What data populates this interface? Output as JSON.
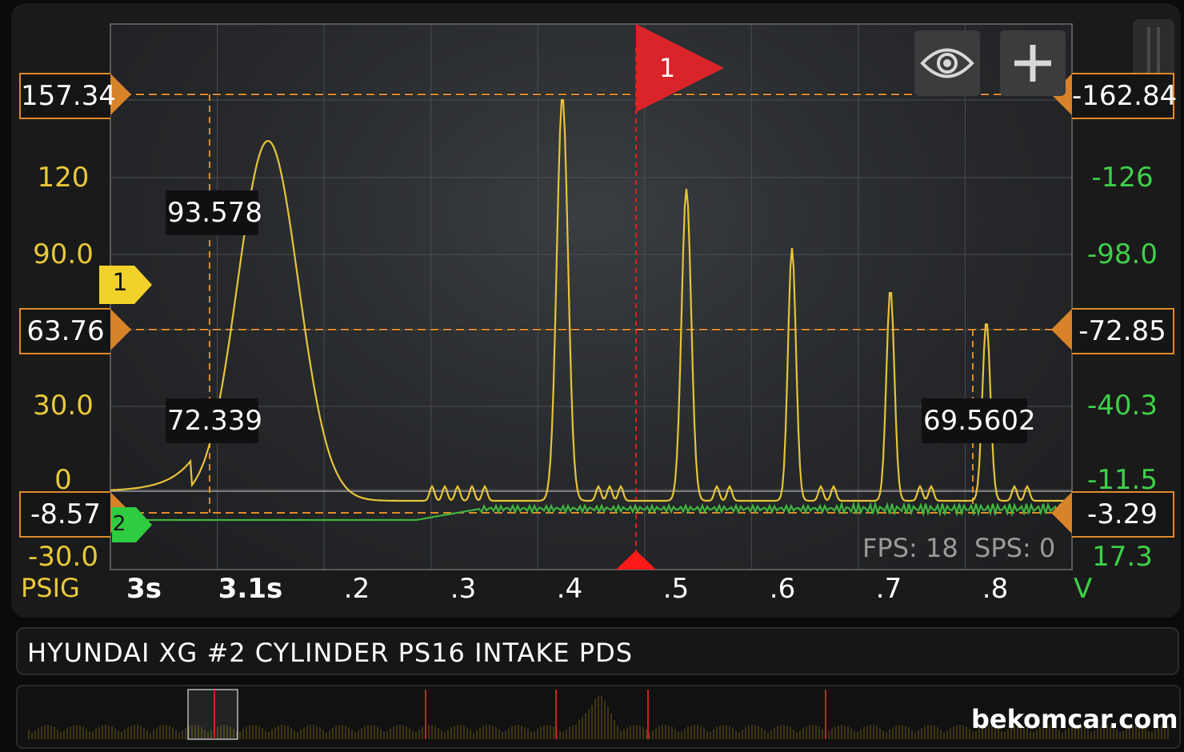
{
  "scope": {
    "left_axis": {
      "unit": "PSIG",
      "ticks": [
        "120",
        "90.0",
        "30.0",
        "0",
        "-30.0"
      ],
      "cursor_top": "157.34",
      "cursor_mid": "63.76",
      "cursor_bottom": "-8.57",
      "color": "#e8c83a"
    },
    "right_axis": {
      "unit": "V",
      "ticks": [
        "-126",
        "-98.0",
        "-40.3",
        "-11.5",
        "17.3"
      ],
      "cursor_top": "-162.84",
      "cursor_mid": "-72.85",
      "cursor_bottom": "-3.29",
      "color": "#3fcf4a"
    },
    "time_axis": {
      "ticks": [
        "3s",
        "3.1s",
        ".2",
        ".3",
        ".4",
        ".5",
        ".6",
        ".7",
        ".8"
      ]
    },
    "channel_markers": [
      "1",
      "2"
    ],
    "trigger_flag": "1",
    "readouts": [
      "93.578",
      "72.339",
      "69.5602"
    ],
    "stats": "FPS: 18  SPS: 0",
    "buttons": {
      "visibility": "eye-icon",
      "add": "plus-icon"
    }
  },
  "title": "HYUNDAI XG #2 CYLINDER PS16 INTAKE PDS",
  "watermark": "bekomcar.com"
}
